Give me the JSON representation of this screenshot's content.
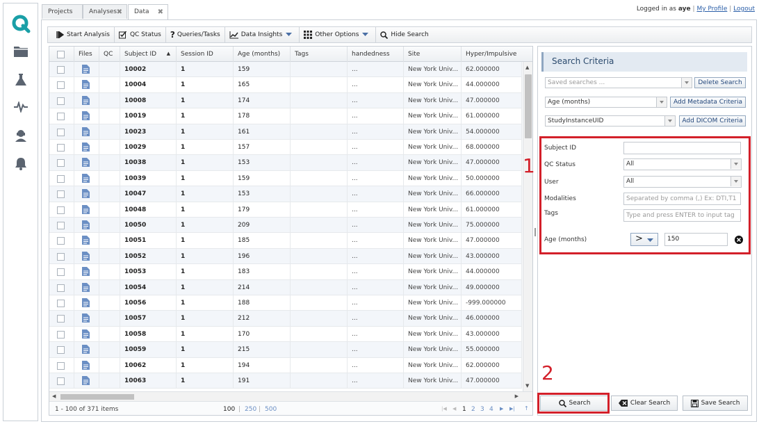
{
  "header": {
    "logged_in_label": "Logged in as",
    "username": "aye",
    "my_profile": "My Profile",
    "logout": "Logout",
    "separator": "|"
  },
  "tabs": [
    {
      "label": "Projects",
      "active": false,
      "closable": false
    },
    {
      "label": "Analyses",
      "active": false,
      "closable": true
    },
    {
      "label": "Data",
      "active": true,
      "closable": true
    }
  ],
  "sidebar_icons": [
    "logo-q-icon",
    "folder-icon",
    "flask-icon",
    "pulse-icon",
    "user-support-icon",
    "bell-icon"
  ],
  "toolbar": {
    "start_analysis": "Start Analysis",
    "qc_status": "QC Status",
    "queries_tasks": "Queries/Tasks",
    "data_insights": "Data Insights",
    "other_options": "Other Options",
    "hide_search": "Hide Search"
  },
  "grid": {
    "columns": [
      "Files",
      "QC",
      "Subject ID",
      "Session ID",
      "Age (months)",
      "Tags",
      "handedness",
      "Site",
      "Hyper/Impulsive"
    ],
    "sort_column": "Subject ID",
    "rows": [
      {
        "subject_id": "10002",
        "session_id": "1",
        "age": "159",
        "handedness": "...",
        "site": "New York Univ...",
        "hyper": "62.000000"
      },
      {
        "subject_id": "10004",
        "session_id": "1",
        "age": "165",
        "handedness": "...",
        "site": "New York Univ...",
        "hyper": "44.000000"
      },
      {
        "subject_id": "10008",
        "session_id": "1",
        "age": "174",
        "handedness": "...",
        "site": "New York Univ...",
        "hyper": "47.000000"
      },
      {
        "subject_id": "10019",
        "session_id": "1",
        "age": "178",
        "handedness": "...",
        "site": "New York Univ...",
        "hyper": "61.000000"
      },
      {
        "subject_id": "10023",
        "session_id": "1",
        "age": "161",
        "handedness": "...",
        "site": "New York Univ...",
        "hyper": "54.000000"
      },
      {
        "subject_id": "10029",
        "session_id": "1",
        "age": "157",
        "handedness": "...",
        "site": "New York Univ...",
        "hyper": "68.000000"
      },
      {
        "subject_id": "10038",
        "session_id": "1",
        "age": "153",
        "handedness": "...",
        "site": "New York Univ...",
        "hyper": "47.000000"
      },
      {
        "subject_id": "10039",
        "session_id": "1",
        "age": "159",
        "handedness": "...",
        "site": "New York Univ...",
        "hyper": "50.000000"
      },
      {
        "subject_id": "10047",
        "session_id": "1",
        "age": "153",
        "handedness": "...",
        "site": "New York Univ...",
        "hyper": "66.000000"
      },
      {
        "subject_id": "10048",
        "session_id": "1",
        "age": "179",
        "handedness": "...",
        "site": "New York Univ...",
        "hyper": "61.000000"
      },
      {
        "subject_id": "10050",
        "session_id": "1",
        "age": "209",
        "handedness": "...",
        "site": "New York Univ...",
        "hyper": "75.000000"
      },
      {
        "subject_id": "10051",
        "session_id": "1",
        "age": "185",
        "handedness": "...",
        "site": "New York Univ...",
        "hyper": "47.000000"
      },
      {
        "subject_id": "10052",
        "session_id": "1",
        "age": "196",
        "handedness": "...",
        "site": "New York Univ...",
        "hyper": "43.000000"
      },
      {
        "subject_id": "10053",
        "session_id": "1",
        "age": "183",
        "handedness": "...",
        "site": "New York Univ...",
        "hyper": "44.000000"
      },
      {
        "subject_id": "10054",
        "session_id": "1",
        "age": "214",
        "handedness": "...",
        "site": "New York Univ...",
        "hyper": "49.000000"
      },
      {
        "subject_id": "10056",
        "session_id": "1",
        "age": "188",
        "handedness": "...",
        "site": "New York Univ...",
        "hyper": "-999.000000"
      },
      {
        "subject_id": "10057",
        "session_id": "1",
        "age": "212",
        "handedness": "...",
        "site": "New York Univ...",
        "hyper": "46.000000"
      },
      {
        "subject_id": "10058",
        "session_id": "1",
        "age": "170",
        "handedness": "...",
        "site": "New York Univ...",
        "hyper": "43.000000"
      },
      {
        "subject_id": "10059",
        "session_id": "1",
        "age": "215",
        "handedness": "...",
        "site": "New York Univ...",
        "hyper": "55.000000"
      },
      {
        "subject_id": "10062",
        "session_id": "1",
        "age": "194",
        "handedness": "...",
        "site": "New York Univ...",
        "hyper": "62.000000"
      },
      {
        "subject_id": "10063",
        "session_id": "1",
        "age": "191",
        "handedness": "...",
        "site": "New York Univ...",
        "hyper": "47.000000"
      }
    ]
  },
  "pager": {
    "summary": "1 - 100 of 371 items",
    "page_sizes": [
      "100",
      "250",
      "500"
    ],
    "pages": [
      "1",
      "2",
      "3",
      "4"
    ],
    "current_page": "1"
  },
  "search": {
    "title": "Search Criteria",
    "saved_searches_placeholder": "Saved searches ...",
    "delete_search": "Delete Search",
    "metadata_select": "Age (months)",
    "add_metadata": "Add Metadata Criteria",
    "dicom_select": "StudyInstanceUID",
    "add_dicom": "Add DICOM Criteria",
    "subject_id_label": "Subject ID",
    "subject_id_value": "",
    "qc_status_label": "QC Status",
    "qc_status_value": "All",
    "user_label": "User",
    "user_value": "All",
    "modalities_label": "Modalities",
    "modalities_placeholder": "Separated by comma (,) Ex: DTI,T1",
    "tags_label": "Tags",
    "tags_placeholder": "Type and press ENTER to input tag",
    "age_label": "Age (months)",
    "age_operator": ">",
    "age_value": "150",
    "search_button": "Search",
    "clear_button": "Clear Search",
    "save_button": "Save Search"
  },
  "annotations": {
    "marker1": "1",
    "marker2": "2",
    "color": "#d3202a"
  },
  "colors": {
    "brand": "#1a9fa7",
    "link": "#2a5ea8",
    "icon_blue": "#6b8fc4"
  }
}
